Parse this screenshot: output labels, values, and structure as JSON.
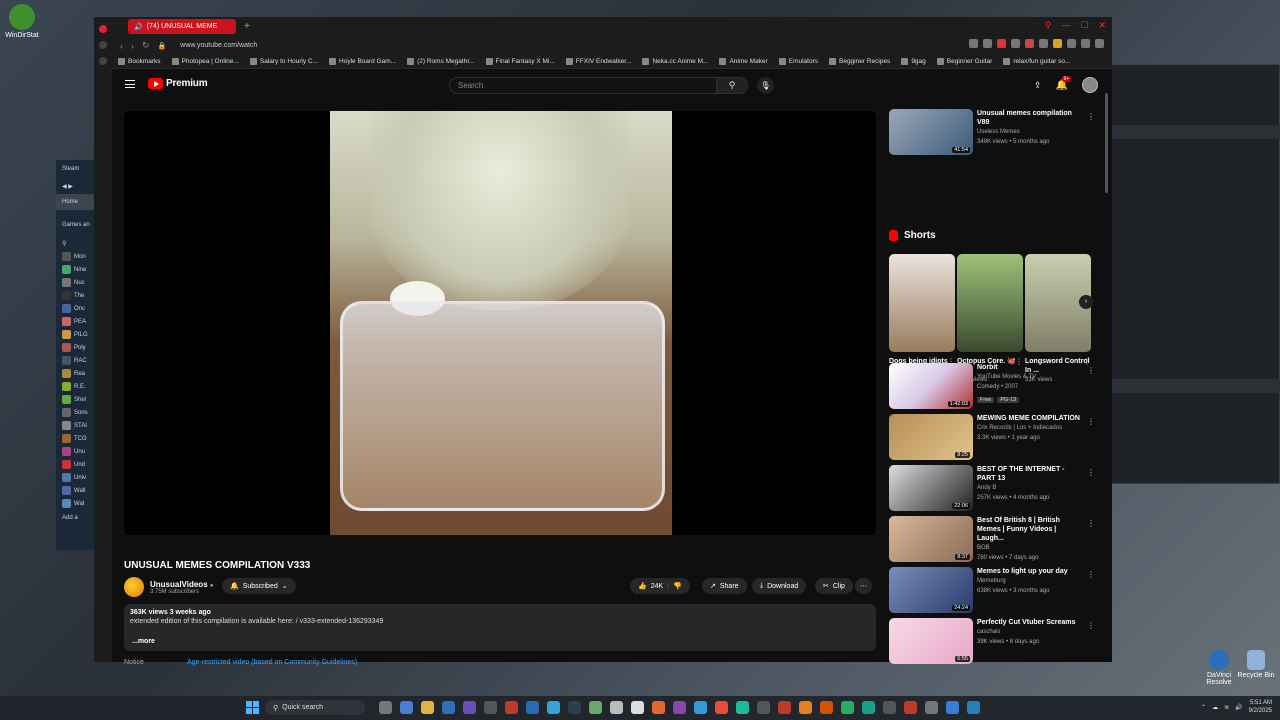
{
  "desktop": {
    "icons": [
      {
        "label": "WinDirStat",
        "color": "#3f8f2f"
      },
      {
        "label": "DaVinci Resolve",
        "color": "#2d6fb7"
      },
      {
        "label": "Recycle Bin",
        "color": "#8fb3d9"
      }
    ]
  },
  "steam": {
    "title": "Steam",
    "home": "Home",
    "games_label": "Games an",
    "items": [
      "Mon",
      "Nine",
      "Nuc",
      "The",
      "Onc",
      "PEA",
      "PILG",
      "Poly",
      "RAC",
      "Rea",
      "R.E.",
      "Shel",
      "Sons",
      "STAI",
      "TCG",
      "Unu",
      "Und",
      "Univ",
      "Wall",
      "Wat"
    ],
    "add": "Add a"
  },
  "browser": {
    "tab_title": "(74) UNUSUAL MEME",
    "url": "www.youtube.com/watch",
    "bookmarks": [
      "Bookmarks",
      "Photopea | Online...",
      "Salary to Hourly C...",
      "Hoyle Board Gam...",
      "(2) Roms Megathr...",
      "Final Fantasy X Mi...",
      "FFXIV Endwalker...",
      "Neka.cc Anime M...",
      "Anime Maker",
      "Emulators",
      "Begginer Recipes",
      "9gag",
      "Beginner Guitar",
      "relax/fun guitar so..."
    ]
  },
  "youtube": {
    "logo_text": "Premium",
    "search_placeholder": "Search",
    "notif_count": "9+",
    "video_title": "UNUSUAL MEMES COMPILATION V333",
    "channel_name": "UnusualVideos",
    "subscribers": "3.75M subscribers",
    "subscribed_label": "Subscribed",
    "likes": "24K",
    "share_label": "Share",
    "download_label": "Download",
    "clip_label": "Clip",
    "views_line": "363K views  3 weeks ago",
    "desc_line": "extended edition of this compilation is available here:  / v333-extended-136293349",
    "more_label": "...more",
    "notice_label": "Notice",
    "notice_link": "Age-restricted video (based on Community Guidelines)",
    "shorts_title": "Shorts",
    "top_video": {
      "title": "Unusual memes compilation V89",
      "channel": "Useless Memes",
      "views": "349K views • 5 months ago",
      "duration": "41:54"
    },
    "shorts": [
      {
        "title": "Dogs being idiots part ...",
        "views": "4M views"
      },
      {
        "title": "Octopus Core. 🐙🐙...",
        "views": "5.5M views"
      },
      {
        "title": "Longsword Control In ...",
        "views": "33K views"
      }
    ],
    "recommended": [
      {
        "title": "Norbit",
        "channel": "YouTube Movies & TV",
        "views": "Comedy • 2007",
        "duration": "1:42:03",
        "chips": [
          "Free",
          "PG-13"
        ]
      },
      {
        "title": "MEWING MEME COMPILATION",
        "channel": "Crix Records | Los + Indiecados",
        "views": "3.3K views • 1 year ago",
        "duration": "8:25",
        "chips": []
      },
      {
        "title": "BEST OF THE INTERNET - PART 13",
        "channel": "Andy B",
        "views": "257K views • 4 months ago",
        "duration": "22:06",
        "chips": []
      },
      {
        "title": "Best Of British 8 | British Memes | Funny Videos | Laugh...",
        "channel": "BOB",
        "views": "780 views • 7 days ago",
        "duration": "8:37",
        "chips": []
      },
      {
        "title": "Memes to light up your day",
        "channel": "Memeburg",
        "views": "638K views • 3 months ago",
        "duration": "24:24",
        "chips": []
      },
      {
        "title": "Perfectly Cut Vtuber Screams",
        "channel": "caschais",
        "views": "39K views • 8 days ago",
        "duration": "6:55",
        "chips": []
      }
    ]
  },
  "taskbar": {
    "search_label": "Quick search",
    "time": "5:51 AM",
    "date": "9/2/2025"
  }
}
